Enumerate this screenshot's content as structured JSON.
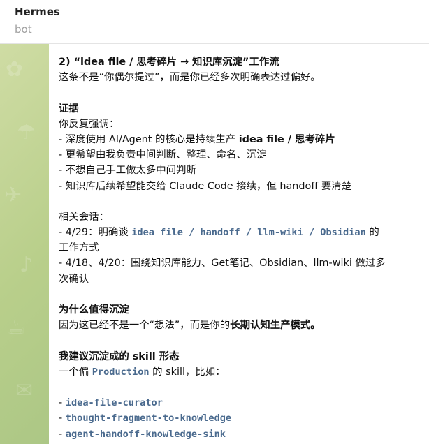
{
  "header": {
    "title": "Hermes",
    "subtitle": "bot"
  },
  "message": {
    "title": "2) “idea file / 思考碎片 → 知识库沉淀”工作流",
    "intro": "这条不是“你偶尔提过”，而是你已经多次明确表达过偏好。",
    "evidence_heading": "证据",
    "evidence_lead": "你反复强调：",
    "evidence_item1_prefix": "- 深度使用 AI/Agent 的核心是持续生产 ",
    "evidence_item1_bold": "idea file / 思考碎片",
    "evidence_item2": "- 更希望由我负责中间判断、整理、命名、沉淀",
    "evidence_item3": "- 不想自己手工做太多中间判断",
    "evidence_item4": "- 知识库后续希望能交给 Claude Code 接续，但 handoff 要清楚",
    "related_heading": "相关会话：",
    "related_item1_prefix": "- 4/29：明确谈 ",
    "related_item1_code": "idea file / handoff / llm-wiki / Obsidian",
    "related_item1_suffix": " 的",
    "related_item1_cont": "工作方式",
    "related_item2": "- 4/18、4/20：围绕知识库能力、Get笔记、Obsidian、llm-wiki 做过多",
    "related_item2_cont": "次确认",
    "why_heading": "为什么值得沉淀",
    "why_prefix": "因为这已经不是一个“想法”，而是你的",
    "why_bold": "长期认知生产模式。",
    "suggest_heading": "我建议沉淀成的 skill 形态",
    "suggest_prefix": "一个偏 ",
    "suggest_code": "Production",
    "suggest_suffix": " 的 skill，比如：",
    "skills": [
      "idea-file-curator",
      "thought-fragment-to-knowledge",
      "agent-handoff-knowledge-sink"
    ]
  }
}
